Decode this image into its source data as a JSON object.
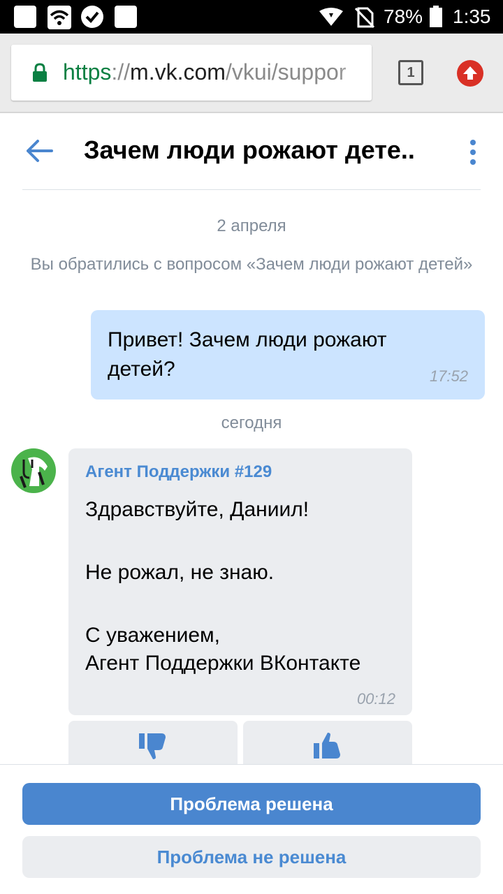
{
  "status_bar": {
    "battery_percent": "78%",
    "time": "1:35",
    "icons": [
      "notification-square-icon",
      "wifi-icon",
      "check-circle-icon",
      "notification-square-icon",
      "wifi-signal-icon",
      "no-sim-icon",
      "battery-icon"
    ]
  },
  "browser": {
    "url_scheme": "https",
    "url_sep": "://",
    "url_host": "m.vk.com",
    "url_path": "/vkui/suppor",
    "tab_count": "1"
  },
  "header": {
    "title": "Зачем люди рожают дете.."
  },
  "chat": {
    "date_1": "2 апреля",
    "service_message": "Вы обратились с вопросом «Зачем люди рожают детей»",
    "outgoing": {
      "text": "Привет! Зачем люди рожают детей?",
      "time": "17:52"
    },
    "date_2": "сегодня",
    "incoming": {
      "author": "Агент Поддержки #129",
      "greeting": "Здравствуйте, Даниил!",
      "body": "Не рожал, не знаю.",
      "sign_1": "С уважением,",
      "sign_2": "Агент Поддержки ВКонтакте",
      "time": "00:12"
    }
  },
  "actions": {
    "solved": "Проблема решена",
    "unsolved": "Проблема не решена"
  },
  "colors": {
    "accent": "#4a86cf",
    "outgoing_bubble": "#cce4ff",
    "incoming_bubble": "#ebedf0",
    "avatar_bg": "#4bb34b"
  }
}
